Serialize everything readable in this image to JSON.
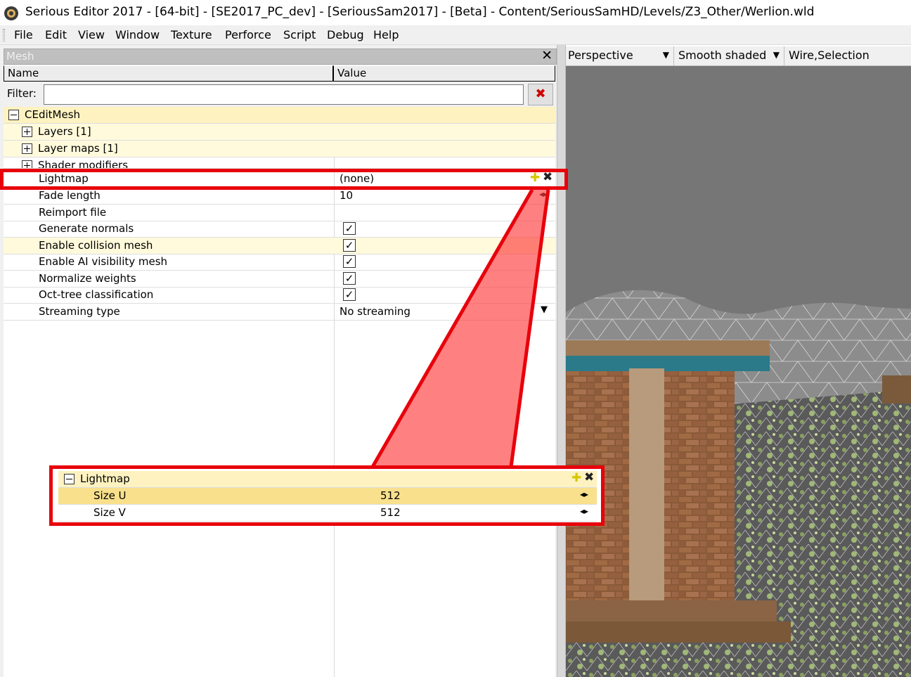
{
  "window": {
    "title": "Serious Editor 2017 - [64-bit] - [SE2017_PC_dev] - [SeriousSam2017] - [Beta] - Content/SeriousSamHD/Levels/Z3_Other/Werlion.wld"
  },
  "menu": [
    "File",
    "Edit",
    "View",
    "Window",
    "Texture",
    "Perforce",
    "Script",
    "Debug",
    "Help"
  ],
  "panel": {
    "title": "Mesh",
    "col_name": "Name",
    "col_value": "Value",
    "filter_label": "Filter:",
    "filter_value": ""
  },
  "tree": {
    "root": "CEditMesh",
    "groups": [
      "Layers [1]",
      "Layer maps [1]",
      "Shader modifiers"
    ],
    "lightmap_name": "Lightmap",
    "lightmap_value": "(none)",
    "fade_name": "Fade length",
    "fade_value": "10",
    "reimport": "Reimport file",
    "checks": [
      {
        "name": "Generate normals",
        "checked": true
      },
      {
        "name": "Enable collision mesh",
        "checked": true
      },
      {
        "name": "Enable AI visibility mesh",
        "checked": true
      },
      {
        "name": "Normalize weights",
        "checked": true
      },
      {
        "name": "Oct-tree classification",
        "checked": true
      }
    ],
    "streaming_name": "Streaming type",
    "streaming_value": "No streaming"
  },
  "callout": {
    "title": "Lightmap",
    "rows": [
      {
        "name": "Size U",
        "value": "512"
      },
      {
        "name": "Size V",
        "value": "512"
      }
    ]
  },
  "viewport": {
    "projection": "Perspective",
    "shading": "Smooth shaded",
    "overlay": "Wire,Selection"
  },
  "colors": {
    "highlight": "#e8000b",
    "category_bg": "#fdf2c0",
    "row_hover": "#fffadc",
    "selected_row": "#f8e08c"
  }
}
